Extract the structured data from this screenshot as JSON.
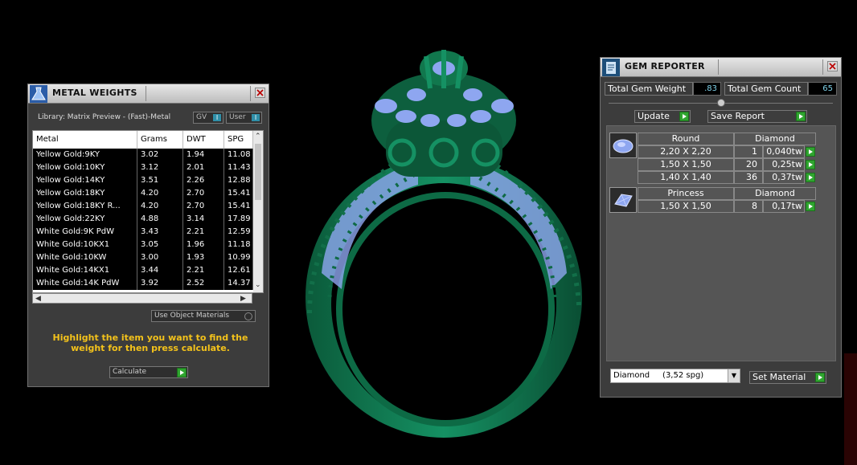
{
  "metal_weights": {
    "title": "METAL WEIGHTS",
    "library_label": "Library: Matrix Preview - (Fast)-Metal",
    "toggle_gv": "GV",
    "toggle_user": "User",
    "toggle_mark": "I",
    "columns": [
      "Metal",
      "Grams",
      "DWT",
      "SPG"
    ],
    "rows": [
      [
        "Yellow Gold:9KY",
        "3.02",
        "1.94",
        "11.08"
      ],
      [
        "Yellow Gold:10KY",
        "3.12",
        "2.01",
        "11.43"
      ],
      [
        "Yellow Gold:14KY",
        "3.51",
        "2.26",
        "12.88"
      ],
      [
        "Yellow Gold:18KY",
        "4.20",
        "2.70",
        "15.41"
      ],
      [
        "Yellow Gold:18KY R...",
        "4.20",
        "2.70",
        "15.41"
      ],
      [
        "Yellow Gold:22KY",
        "4.88",
        "3.14",
        "17.89"
      ],
      [
        "White Gold:9K PdW",
        "3.43",
        "2.21",
        "12.59"
      ],
      [
        "White Gold:10KX1",
        "3.05",
        "1.96",
        "11.18"
      ],
      [
        "White Gold:10KW",
        "3.00",
        "1.93",
        "10.99"
      ],
      [
        "White Gold:14KX1",
        "3.44",
        "2.21",
        "12.61"
      ],
      [
        "White Gold:14K PdW",
        "3.92",
        "2.52",
        "14.37"
      ]
    ],
    "use_object_materials": "Use Object Materials",
    "instruction": "Highlight the item you want to find the weight for then press calculate.",
    "calculate_label": "Calculate"
  },
  "gem_reporter": {
    "title": "GEM REPORTER",
    "total_weight_label": "Total Gem Weight",
    "total_weight_value": ".83",
    "total_count_label": "Total Gem Count",
    "total_count_value": "65",
    "update_label": "Update",
    "save_report_label": "Save Report",
    "groups": [
      {
        "shape": "Round",
        "material": "Diamond",
        "rows": [
          [
            "2,20 X 2,20",
            "1",
            "0,040tw"
          ],
          [
            "1,50 X 1,50",
            "20",
            "0,25tw"
          ],
          [
            "1,40 X 1,40",
            "36",
            "0,37tw"
          ]
        ]
      },
      {
        "shape": "Princess",
        "material": "Diamond",
        "rows": [
          [
            "1,50 X 1,50",
            "8",
            "0,17tw"
          ]
        ]
      }
    ],
    "material_select": "Diamond     (3,52 spg)",
    "set_material_label": "Set Material"
  },
  "viewport": {
    "ring_color": "#0f6a45",
    "gem_color": "#8ea6f0",
    "background": "#000000"
  }
}
